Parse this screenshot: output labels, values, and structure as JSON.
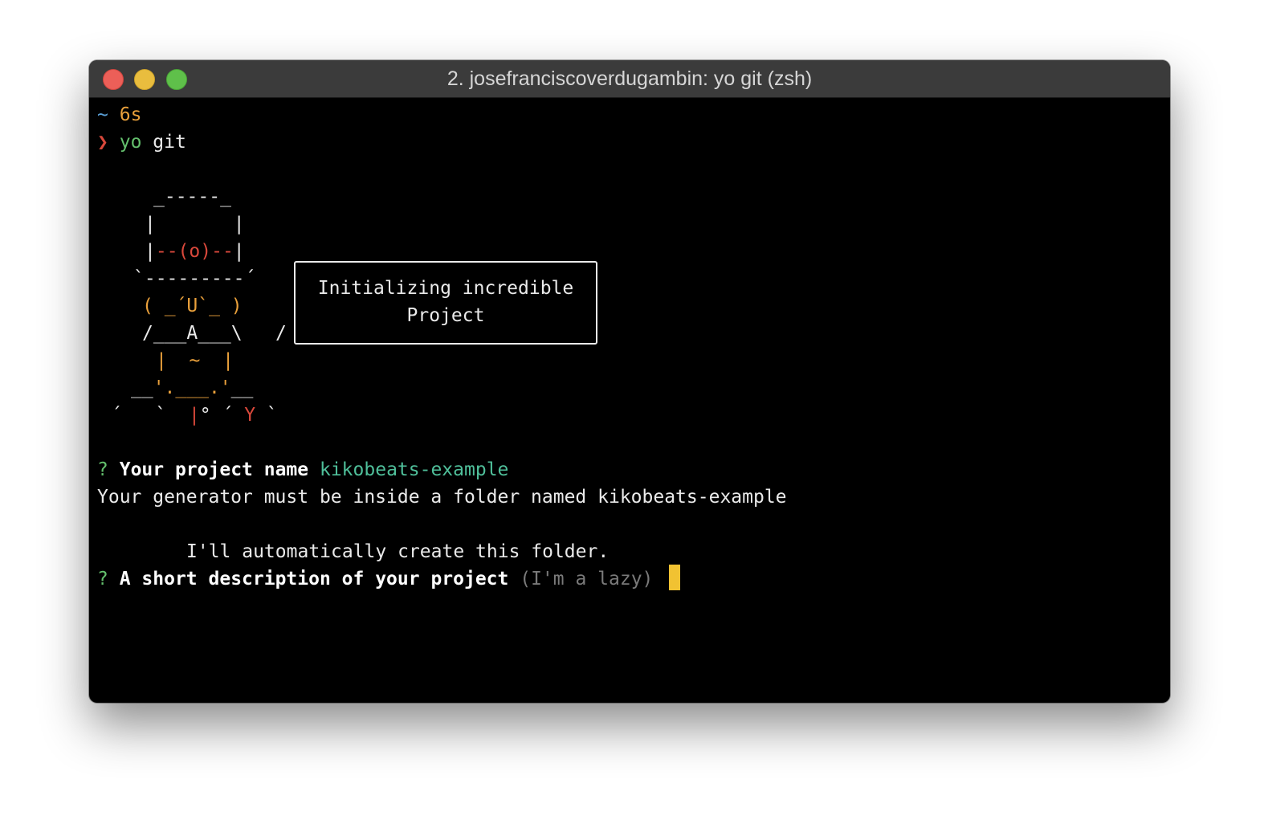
{
  "window": {
    "title": "2. josefranciscoverdugambin: yo git (zsh)",
    "traffic_lights": [
      "close-button",
      "minimize-button",
      "zoom-button"
    ]
  },
  "prompt": {
    "dir_symbol": "~",
    "duration": "6s",
    "arrow": "❯",
    "cmd_yo": "yo",
    "cmd_arg": "git"
  },
  "yeoman": {
    "art": [
      "_-----_",
      "|       |",
      "|--(o)--|",
      "`---------´",
      "( _´U`_ )",
      "/___A___\\",
      "/",
      "|  ~  |",
      "__'.___.'__",
      "´   `  |° ´ Y `"
    ],
    "bubble_line1": "Initializing incredible",
    "bubble_line2": "Project"
  },
  "questions": {
    "q1_mark": "?",
    "q1_label": "Your project name",
    "q1_answer": "kikobeats-example",
    "info_line": "Your generator must be inside a folder named kikobeats-example",
    "info_line2": "I'll automatically create this folder.",
    "q2_mark": "?",
    "q2_label": "A short description of your project",
    "q2_default": "(I'm a lazy)"
  },
  "colors": {
    "terminal_bg": "#000000",
    "titlebar_bg": "#3b3b3b",
    "cursor": "#f1c232",
    "answer": "#4fbf9a",
    "prompt_arrow": "#d9483b"
  }
}
